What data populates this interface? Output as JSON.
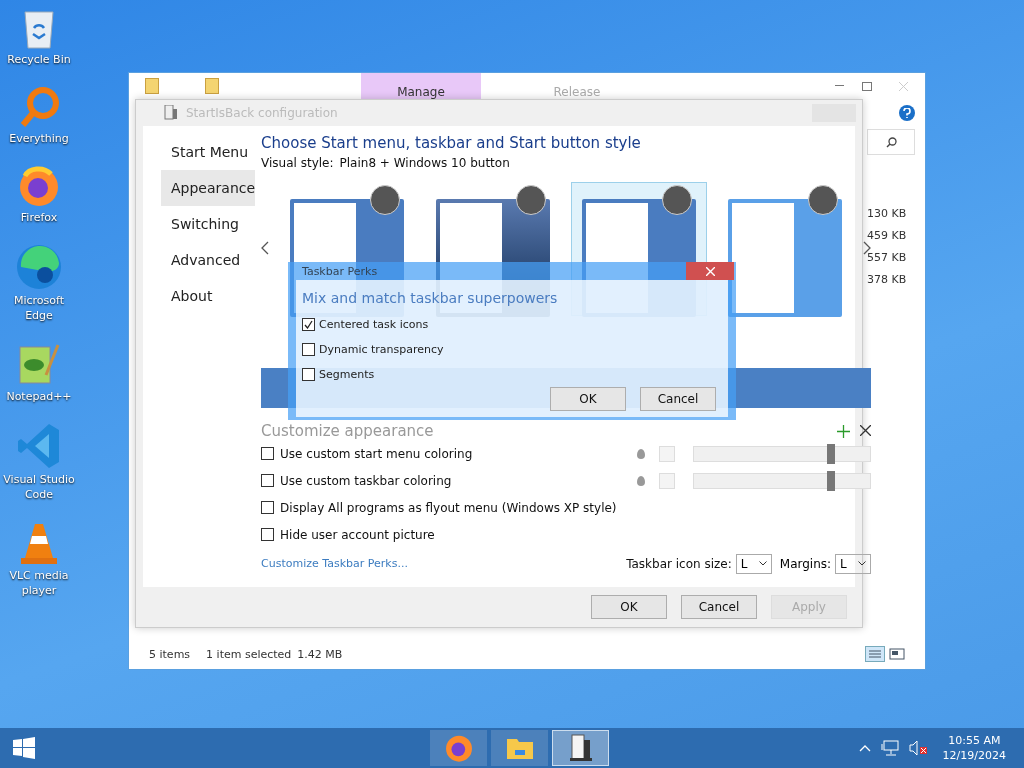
{
  "desktop_icons": [
    {
      "kind": "recycle",
      "label": "Recycle Bin"
    },
    {
      "kind": "search",
      "label": "Everything"
    },
    {
      "kind": "firefox",
      "label": "Firefox"
    },
    {
      "kind": "edge",
      "label": "Microsoft Edge"
    },
    {
      "kind": "notepad",
      "label": "Notepad++"
    },
    {
      "kind": "vscode",
      "label": "Visual Studio Code"
    },
    {
      "kind": "vlc",
      "label": "VLC media player"
    }
  ],
  "explorer": {
    "ribbon_tabs": [
      {
        "label": "Manage",
        "selected": true
      },
      {
        "label": "Release",
        "selected": false
      }
    ],
    "sizes": [
      "130 KB",
      "459 KB",
      "557 KB",
      "378 KB"
    ],
    "status_bar": {
      "items": "5 items",
      "selection": "1 item selected",
      "size": "1.42 MB"
    }
  },
  "config": {
    "title": "StartIsBack configuration",
    "nav": [
      {
        "label": "Start Menu",
        "selected": false
      },
      {
        "label": "Appearance",
        "selected": true
      },
      {
        "label": "Switching",
        "selected": false
      },
      {
        "label": "Advanced",
        "selected": false
      },
      {
        "label": "About",
        "selected": false
      }
    ],
    "heading": "Choose Start menu, taskbar and Start button style",
    "visual_style_label": "Visual style:",
    "visual_style": "Plain8 + Windows 10 button",
    "styles": [
      {
        "kind": "plain",
        "selected": false
      },
      {
        "kind": "dark",
        "selected": false
      },
      {
        "kind": "plain",
        "selected": true
      },
      {
        "kind": "light",
        "selected": false
      }
    ],
    "section": "Customize appearance",
    "options": [
      {
        "kind": "slider",
        "label": "Use custom start menu coloring",
        "checked": false,
        "level": 0.78
      },
      {
        "kind": "slider",
        "label": "Use custom taskbar coloring",
        "checked": false,
        "level": 0.78
      },
      {
        "kind": "plain",
        "label": "Display All programs as flyout menu (Windows XP style)",
        "checked": false
      },
      {
        "kind": "plain",
        "label": "Hide user account picture",
        "checked": false
      }
    ],
    "link": "Customize Taskbar Perks...",
    "icon_size_label": "Taskbar icon size:",
    "icon_size": "L",
    "margins_label": "Margins:",
    "margins": "L",
    "buttons": [
      {
        "label": "OK",
        "disabled": false
      },
      {
        "label": "Cancel",
        "disabled": false
      },
      {
        "label": "Apply",
        "disabled": true
      }
    ]
  },
  "perks": {
    "title": "Taskbar Perks",
    "heading": "Mix and match taskbar superpowers",
    "options": [
      {
        "label": "Centered task icons",
        "checked": true
      },
      {
        "label": "Dynamic transparency",
        "checked": false
      },
      {
        "label": "Segments",
        "checked": false
      }
    ],
    "buttons": [
      "OK",
      "Cancel"
    ]
  },
  "taskbar": {
    "apps": [
      {
        "kind": "firefox",
        "selected": false
      },
      {
        "kind": "folder",
        "selected": false
      },
      {
        "kind": "config",
        "selected": true
      }
    ],
    "time": "10:55 AM",
    "date": "12/19/2024"
  }
}
